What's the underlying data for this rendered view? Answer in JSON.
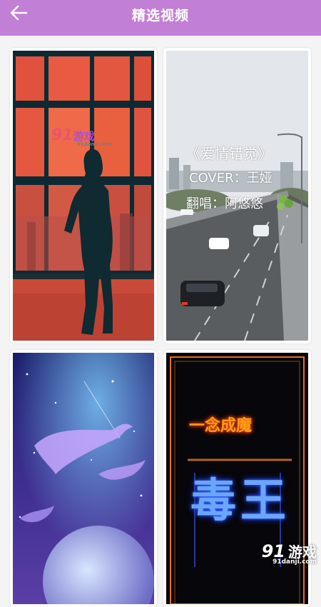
{
  "header": {
    "title": "精选视频",
    "back_icon": "arrow-left-icon",
    "background": "#c17fd6"
  },
  "videos": [
    {
      "scene": "silhouette-woman-window",
      "watermark": {
        "logo": "91",
        "name": "游戏",
        "url": "91danji.com"
      }
    },
    {
      "scene": "highway-cars",
      "overlay_lines": [
        "《爱情错觉》",
        "COVER：王娅",
        "翻唱：阿悠悠"
      ]
    },
    {
      "scene": "galaxy-whales"
    },
    {
      "scene": "neon-sign",
      "neon_title": "一念成魔",
      "neon_big": "毒王"
    }
  ],
  "corner_watermark": {
    "logo": "91",
    "name": "游戏",
    "url": "91danji.com"
  }
}
